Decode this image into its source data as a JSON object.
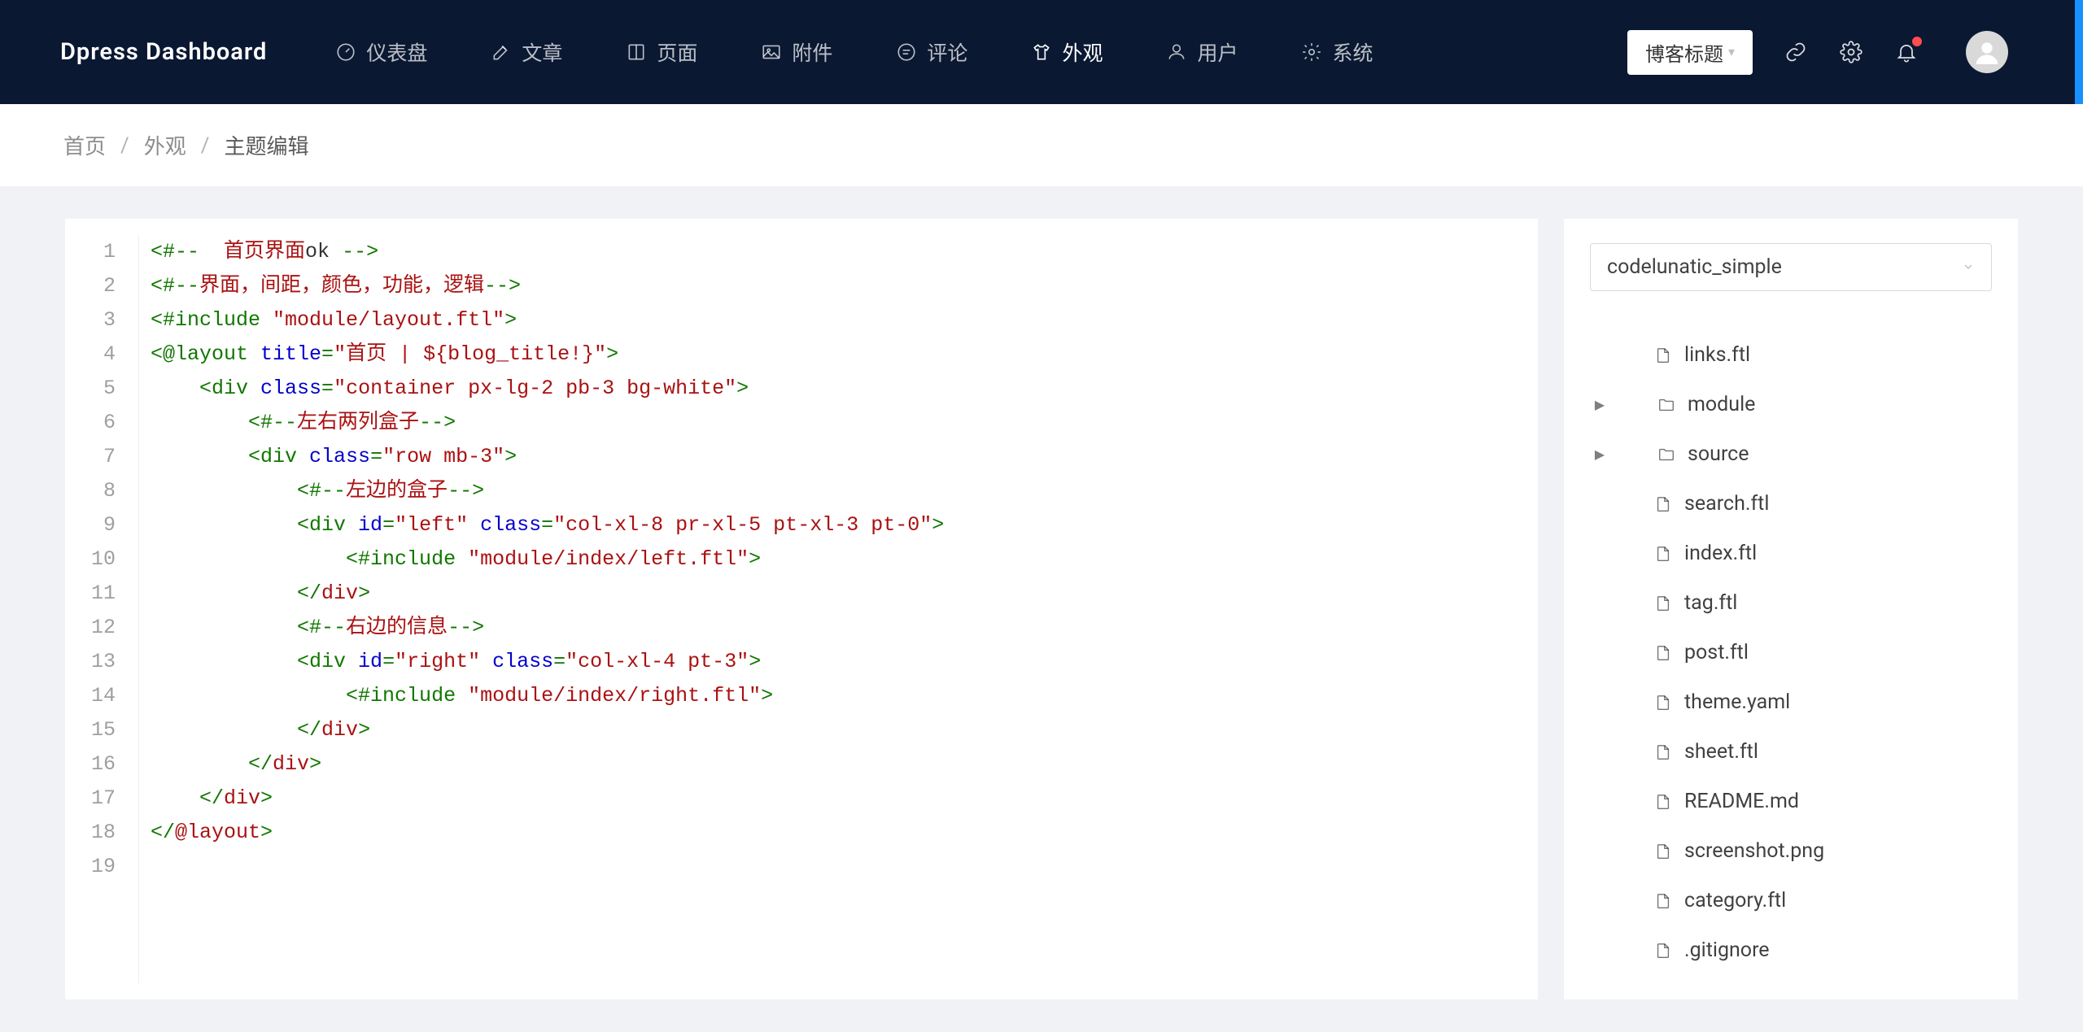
{
  "brand": "Dpress  Dashboard",
  "nav": [
    {
      "label": "仪表盘",
      "icon": "gauge"
    },
    {
      "label": "文章",
      "icon": "edit"
    },
    {
      "label": "页面",
      "icon": "book"
    },
    {
      "label": "附件",
      "icon": "image"
    },
    {
      "label": "评论",
      "icon": "comment"
    },
    {
      "label": "外观",
      "icon": "shirt",
      "active": true
    },
    {
      "label": "用户",
      "icon": "user"
    },
    {
      "label": "系统",
      "icon": "gear"
    }
  ],
  "blog_title_button": "博客标题",
  "breadcrumb": [
    "首页",
    "外观",
    "主题编辑"
  ],
  "code_lines": [
    [
      {
        "t": "tag",
        "v": "<#--"
      },
      {
        "t": "text",
        "v": "  "
      },
      {
        "t": "cn",
        "v": "首页界面"
      },
      {
        "t": "text",
        "v": "ok "
      },
      {
        "t": "tag",
        "v": "-->"
      }
    ],
    [
      {
        "t": "tag",
        "v": "<#--"
      },
      {
        "t": "cn",
        "v": "界面，间距，颜色，功能，逻辑"
      },
      {
        "t": "tag",
        "v": "-->"
      }
    ],
    [
      {
        "t": "tag",
        "v": "<#include "
      },
      {
        "t": "str",
        "v": "\"module/layout.ftl\""
      },
      {
        "t": "tag",
        "v": ">"
      }
    ],
    [
      {
        "t": "tag",
        "v": "<@layout "
      },
      {
        "t": "attr",
        "v": "title"
      },
      {
        "t": "tag",
        "v": "="
      },
      {
        "t": "str",
        "v": "\""
      },
      {
        "t": "cn",
        "v": "首页"
      },
      {
        "t": "str",
        "v": " | ${blog_title!}\""
      },
      {
        "t": "tag",
        "v": ">"
      }
    ],
    [
      {
        "t": "text",
        "v": "    "
      },
      {
        "t": "tag",
        "v": "<div "
      },
      {
        "t": "attr",
        "v": "class"
      },
      {
        "t": "tag",
        "v": "="
      },
      {
        "t": "str",
        "v": "\"container px-lg-2 pb-3 bg-white\""
      },
      {
        "t": "tag",
        "v": ">"
      }
    ],
    [
      {
        "t": "text",
        "v": "        "
      },
      {
        "t": "tag",
        "v": "<#--"
      },
      {
        "t": "cn",
        "v": "左右两列盒子"
      },
      {
        "t": "tag",
        "v": "-->"
      }
    ],
    [
      {
        "t": "text",
        "v": "        "
      },
      {
        "t": "tag",
        "v": "<div "
      },
      {
        "t": "attr",
        "v": "class"
      },
      {
        "t": "tag",
        "v": "="
      },
      {
        "t": "str",
        "v": "\"row mb-3\""
      },
      {
        "t": "tag",
        "v": ">"
      }
    ],
    [
      {
        "t": "text",
        "v": "            "
      },
      {
        "t": "tag",
        "v": "<#--"
      },
      {
        "t": "cn",
        "v": "左边的盒子"
      },
      {
        "t": "tag",
        "v": "-->"
      }
    ],
    [
      {
        "t": "text",
        "v": "            "
      },
      {
        "t": "tag",
        "v": "<div "
      },
      {
        "t": "attr",
        "v": "id"
      },
      {
        "t": "tag",
        "v": "="
      },
      {
        "t": "str",
        "v": "\"left\""
      },
      {
        "t": "tag",
        "v": " "
      },
      {
        "t": "attr",
        "v": "class"
      },
      {
        "t": "tag",
        "v": "="
      },
      {
        "t": "str",
        "v": "\"col-xl-8 pr-xl-5 pt-xl-3 pt-0\""
      },
      {
        "t": "tag",
        "v": ">"
      }
    ],
    [
      {
        "t": "text",
        "v": "                "
      },
      {
        "t": "tag",
        "v": "<#include "
      },
      {
        "t": "str",
        "v": "\"module/index/left.ftl\""
      },
      {
        "t": "tag",
        "v": ">"
      }
    ],
    [
      {
        "t": "text",
        "v": "            "
      },
      {
        "t": "tag",
        "v": "</"
      },
      {
        "t": "str",
        "v": "div"
      },
      {
        "t": "tag",
        "v": ">"
      }
    ],
    [
      {
        "t": "text",
        "v": "            "
      },
      {
        "t": "tag",
        "v": "<#--"
      },
      {
        "t": "cn",
        "v": "右边的信息"
      },
      {
        "t": "tag",
        "v": "-->"
      }
    ],
    [
      {
        "t": "text",
        "v": "            "
      },
      {
        "t": "tag",
        "v": "<div "
      },
      {
        "t": "attr",
        "v": "id"
      },
      {
        "t": "tag",
        "v": "="
      },
      {
        "t": "str",
        "v": "\"right\""
      },
      {
        "t": "tag",
        "v": " "
      },
      {
        "t": "attr",
        "v": "class"
      },
      {
        "t": "tag",
        "v": "="
      },
      {
        "t": "str",
        "v": "\"col-xl-4 pt-3\""
      },
      {
        "t": "tag",
        "v": ">"
      }
    ],
    [
      {
        "t": "text",
        "v": "                "
      },
      {
        "t": "tag",
        "v": "<#include "
      },
      {
        "t": "str",
        "v": "\"module/index/right.ftl\""
      },
      {
        "t": "tag",
        "v": ">"
      }
    ],
    [
      {
        "t": "text",
        "v": "            "
      },
      {
        "t": "tag",
        "v": "</"
      },
      {
        "t": "str",
        "v": "div"
      },
      {
        "t": "tag",
        "v": ">"
      }
    ],
    [
      {
        "t": "text",
        "v": "        "
      },
      {
        "t": "tag",
        "v": "</"
      },
      {
        "t": "str",
        "v": "div"
      },
      {
        "t": "tag",
        "v": ">"
      }
    ],
    [
      {
        "t": "text",
        "v": "    "
      },
      {
        "t": "tag",
        "v": "</"
      },
      {
        "t": "str",
        "v": "div"
      },
      {
        "t": "tag",
        "v": ">"
      }
    ],
    [
      {
        "t": "tag",
        "v": "</"
      },
      {
        "t": "str",
        "v": "@layout"
      },
      {
        "t": "tag",
        "v": ">"
      }
    ],
    []
  ],
  "theme_select": "codelunatic_simple",
  "tree": [
    {
      "type": "file",
      "name": "links.ftl"
    },
    {
      "type": "folder",
      "name": "module"
    },
    {
      "type": "folder",
      "name": "source"
    },
    {
      "type": "file",
      "name": "search.ftl"
    },
    {
      "type": "file",
      "name": "index.ftl"
    },
    {
      "type": "file",
      "name": "tag.ftl"
    },
    {
      "type": "file",
      "name": "post.ftl"
    },
    {
      "type": "file",
      "name": "theme.yaml"
    },
    {
      "type": "file",
      "name": "sheet.ftl"
    },
    {
      "type": "file",
      "name": "README.md"
    },
    {
      "type": "file",
      "name": "screenshot.png"
    },
    {
      "type": "file",
      "name": "category.ftl"
    },
    {
      "type": "file",
      "name": ".gitignore"
    }
  ]
}
